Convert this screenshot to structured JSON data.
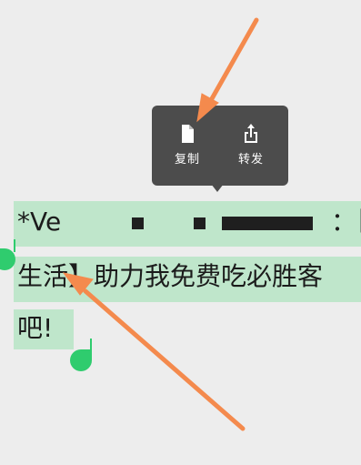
{
  "popup_menu": {
    "copy_label": "复制",
    "forward_label": "转发",
    "copy_icon": "document-icon",
    "forward_icon": "share-upload-icon"
  },
  "message": {
    "line1_start": "*Ve",
    "line1_end": "：【",
    "line2": "生活】助力我免费吃必胜客",
    "line3": "吧!"
  },
  "colors": {
    "background": "#ededed",
    "popup": "#4c4c4c",
    "selection": "#bfe6cb",
    "handle": "#2fcc6e",
    "annotation_arrow": "#f48a4d"
  }
}
